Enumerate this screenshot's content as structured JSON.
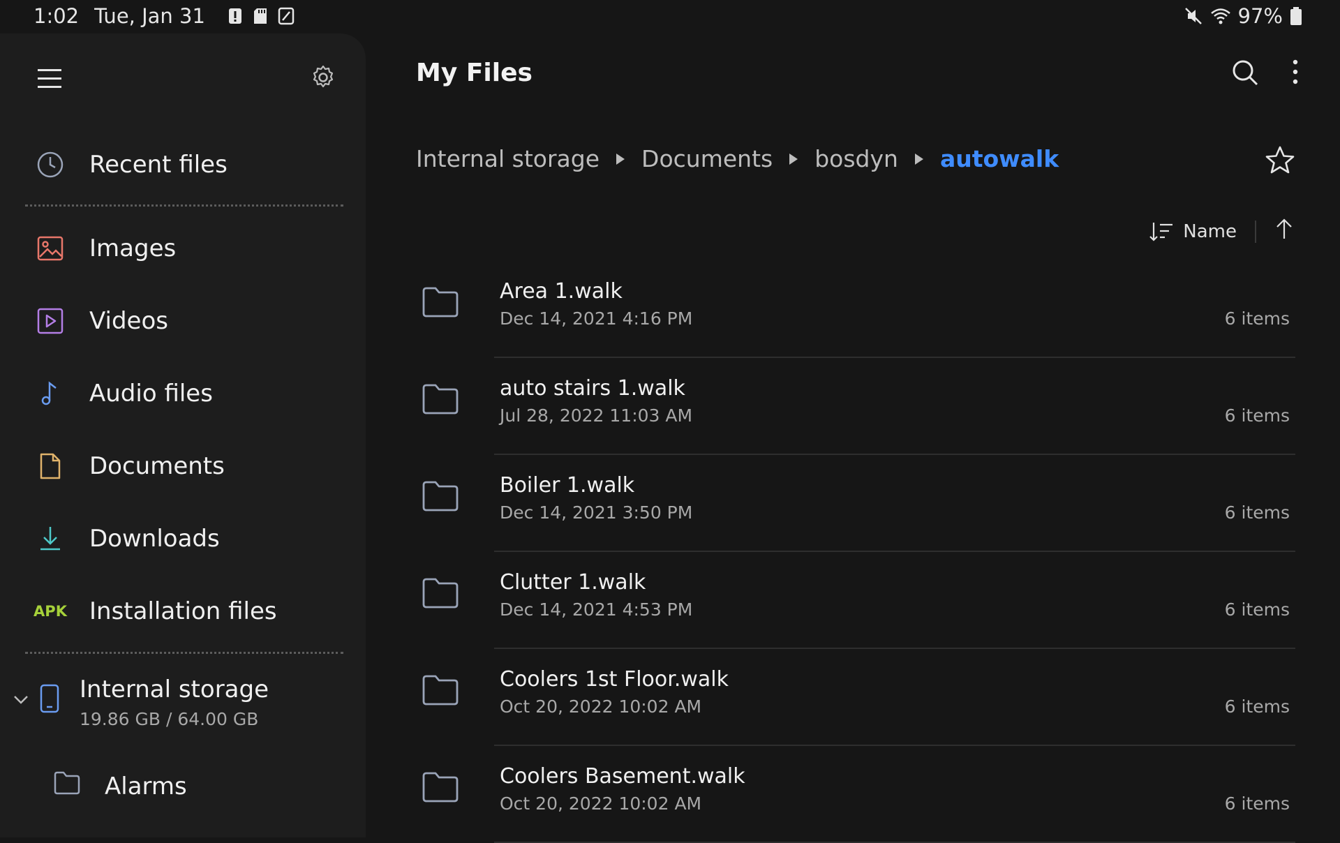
{
  "status": {
    "time": "1:02",
    "date": "Tue, Jan 31",
    "battery": "97%"
  },
  "sidebar": {
    "recent_label": "Recent files",
    "categories": [
      {
        "label": "Images",
        "icon": "image-icon",
        "color": "#e8776a"
      },
      {
        "label": "Videos",
        "icon": "video-icon",
        "color": "#b47ee6"
      },
      {
        "label": "Audio files",
        "icon": "music-note-icon",
        "color": "#6a9cf0"
      },
      {
        "label": "Documents",
        "icon": "document-icon",
        "color": "#e0b36b"
      },
      {
        "label": "Downloads",
        "icon": "download-icon",
        "color": "#4ec9c9"
      },
      {
        "label": "Installation files",
        "icon": "apk-icon",
        "color": "#a6d13a",
        "badge": "APK"
      }
    ],
    "storage": {
      "name": "Internal storage",
      "size": "19.86 GB / 64.00 GB"
    },
    "folder": "Alarms"
  },
  "main": {
    "title": "My Files",
    "breadcrumb": [
      "Internal storage",
      "Documents",
      "bosdyn",
      "autowalk"
    ],
    "sort_label": "Name",
    "files": [
      {
        "name": "Area 1.walk",
        "date": "Dec 14, 2021 4:16 PM",
        "count": "6 items"
      },
      {
        "name": "auto stairs 1.walk",
        "date": "Jul 28, 2022 11:03 AM",
        "count": "6 items"
      },
      {
        "name": "Boiler 1.walk",
        "date": "Dec 14, 2021 3:50 PM",
        "count": "6 items"
      },
      {
        "name": "Clutter 1.walk",
        "date": "Dec 14, 2021 4:53 PM",
        "count": "6 items"
      },
      {
        "name": "Coolers 1st Floor.walk",
        "date": "Oct 20, 2022 10:02 AM",
        "count": "6 items"
      },
      {
        "name": "Coolers Basement.walk",
        "date": "Oct 20, 2022 10:02 AM",
        "count": "6 items"
      }
    ]
  },
  "colors": {
    "accent": "#3f8cff",
    "background": "#161616",
    "sidebar": "#1d1d1d"
  }
}
